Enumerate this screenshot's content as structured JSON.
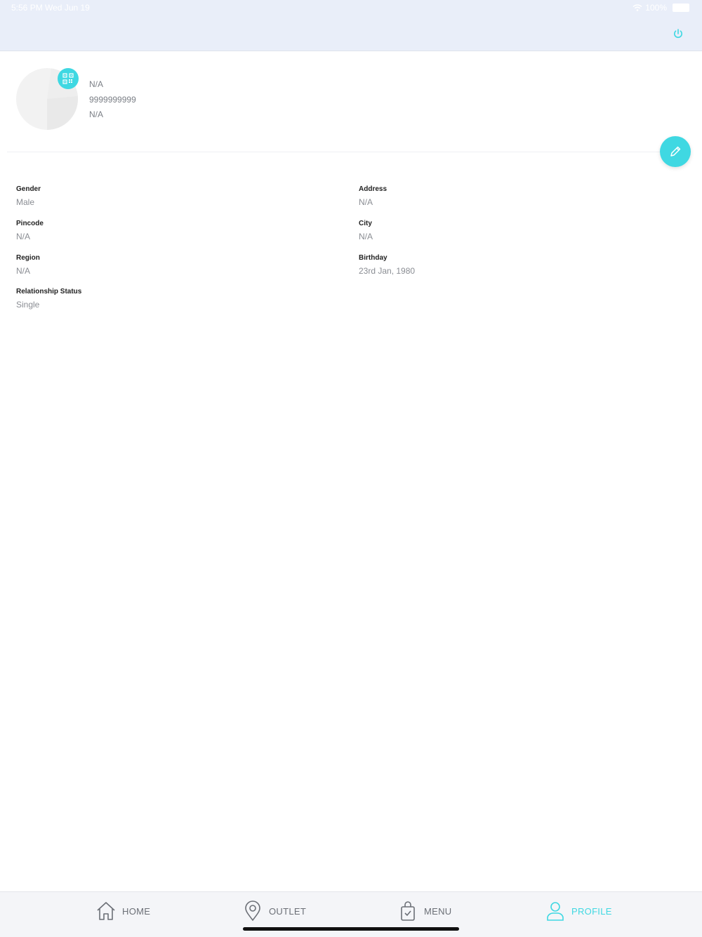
{
  "status_bar": {
    "time": "5:56 PM   Wed Jun 19",
    "battery": "100%"
  },
  "profile": {
    "name": "N/A",
    "phone": "9999999999",
    "email": "N/A"
  },
  "details": [
    {
      "label": "Gender",
      "value": "Male"
    },
    {
      "label": "Address",
      "value": "N/A"
    },
    {
      "label": "Pincode",
      "value": "N/A"
    },
    {
      "label": "City",
      "value": "N/A"
    },
    {
      "label": "Region",
      "value": "N/A"
    },
    {
      "label": "Birthday",
      "value": "23rd Jan, 1980"
    },
    {
      "label": "Relationship Status",
      "value": "Single"
    }
  ],
  "tabs": [
    {
      "label": "HOME",
      "icon": "home-icon"
    },
    {
      "label": "OUTLET",
      "icon": "location-pin-icon"
    },
    {
      "label": "MENU",
      "icon": "shopping-bag-icon"
    },
    {
      "label": "PROFILE",
      "icon": "user-icon",
      "active": true
    }
  ],
  "colors": {
    "accent": "#3fd8e2",
    "topbar": "#e9eef9"
  }
}
